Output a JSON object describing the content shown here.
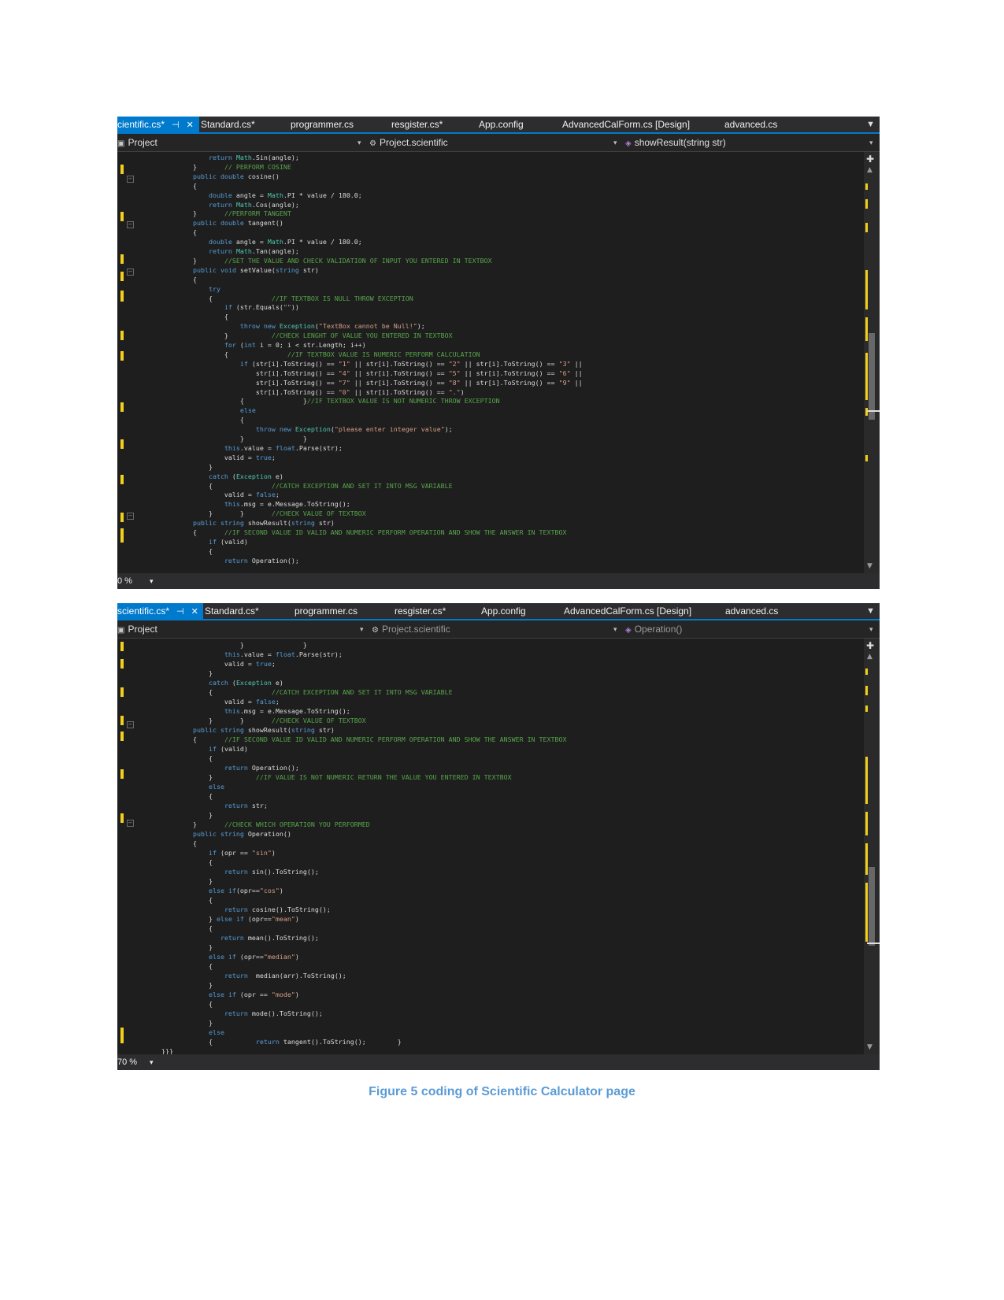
{
  "screenshots": [
    {
      "tabs": [
        "cientific.cs*",
        "Standard.cs*",
        "programmer.cs",
        "resgister.cs*",
        "App.config",
        "AdvancedCalForm.cs [Design]",
        "advanced.cs"
      ],
      "active_tab_pin": "⊣",
      "active_tab_close": "✕",
      "navbar": {
        "project": "Project",
        "class": "Project.scientific",
        "member": "showResult(string str)"
      },
      "zoom": "0 %",
      "code_lines": [
        "            return Math.Sin(angle);",
        "        }       // PERFORM COSINE",
        "        public double cosine()",
        "        {",
        "            double angle = Math.PI * value / 180.0;",
        "            return Math.Cos(angle);",
        "        }       //PERFORM TANGENT",
        "        public double tangent()",
        "        {",
        "            double angle = Math.PI * value / 180.0;",
        "            return Math.Tan(angle);",
        "        }       //SET THE VALUE AND CHECK VALIDATION OF INPUT YOU ENTERED IN TEXTBOX",
        "        public void setValue(string str)",
        "        {",
        "            try",
        "            {               //IF TEXTBOX IS NULL THROW EXCEPTION",
        "                if (str.Equals(\"\"))",
        "                {",
        "                    throw new Exception(\"TextBox cannot be Null!\");",
        "                }           //CHECK LENGHT OF VALUE YOU ENTERED IN TEXTBOX",
        "                for (int i = 0; i < str.Length; i++)",
        "                {               //IF TEXTBOX VALUE IS NUMERIC PERFORM CALCULATION",
        "                    if (str[i].ToString() == \"1\" || str[i].ToString() == \"2\" || str[i].ToString() == \"3\" ||",
        "                        str[i].ToString() == \"4\" || str[i].ToString() == \"5\" || str[i].ToString() == \"6\" ||",
        "                        str[i].ToString() == \"7\" || str[i].ToString() == \"8\" || str[i].ToString() == \"9\" ||",
        "                        str[i].ToString() == \"0\" || str[i].ToString() == \".\")",
        "                    {               }//IF TEXTBOX VALUE IS NOT NUMERIC THROW EXCEPTION",
        "                    else",
        "                    {",
        "                        throw new Exception(\"please enter integer value\");",
        "                    }               }",
        "                this.value = float.Parse(str);",
        "                valid = true;",
        "            }",
        "            catch (Exception e)",
        "            {               //CATCH EXCEPTION AND SET IT INTO MSG VARIABLE",
        "                valid = false;",
        "                this.msg = e.Message.ToString();",
        "            }       }       //CHECK VALUE OF TEXTBOX",
        "        public string showResult(string str)",
        "        {       //IF SECOND VALUE ID VALID AND NUMERIC PERFORM OPERATION AND SHOW THE ANSWER IN TEXTBOX",
        "            if (valid)",
        "            {",
        "                return Operation();"
      ]
    },
    {
      "tabs": [
        "scientific.cs*",
        "Standard.cs*",
        "programmer.cs",
        "resgister.cs*",
        "App.config",
        "AdvancedCalForm.cs [Design]",
        "advanced.cs"
      ],
      "active_tab_pin": "⊣",
      "active_tab_close": "✕",
      "navbar": {
        "project": "Project",
        "class": "Project.scientific",
        "member": "Operation()"
      },
      "zoom": "70 %",
      "code_lines": [
        "                    }               }",
        "                this.value = float.Parse(str);",
        "                valid = true;",
        "            }",
        "            catch (Exception e)",
        "            {               //CATCH EXCEPTION AND SET IT INTO MSG VARIABLE",
        "                valid = false;",
        "                this.msg = e.Message.ToString();",
        "            }       }       //CHECK VALUE OF TEXTBOX",
        "        public string showResult(string str)",
        "        {       //IF SECOND VALUE ID VALID AND NUMERIC PERFORM OPERATION AND SHOW THE ANSWER IN TEXTBOX",
        "            if (valid)",
        "            {",
        "                return Operation();",
        "            }           //IF VALUE IS NOT NUMERIC RETURN THE VALUE YOU ENTERED IN TEXTBOX",
        "            else",
        "            {",
        "                return str;",
        "            }",
        "        }       //CHECK WHICH OPERATION YOU PERFORMED",
        "        public string Operation()",
        "        {",
        "            if (opr == \"sin\")",
        "            {",
        "                return sin().ToString();",
        "            }",
        "            else if(opr==\"cos\")",
        "            {",
        "                return cosine().ToString();",
        "            } else if (opr==\"mean\")",
        "            {",
        "               return mean().ToString();",
        "            }",
        "            else if (opr==\"median\")",
        "            {",
        "                return  median(arr).ToString();",
        "            }",
        "            else if (opr == \"mode\")",
        "            {",
        "                return mode().ToString();",
        "            }",
        "            else",
        "            {           return tangent().ToString();        }",
        "}}}"
      ]
    }
  ],
  "caption": "Figure 5 coding of Scientific Calculator page"
}
